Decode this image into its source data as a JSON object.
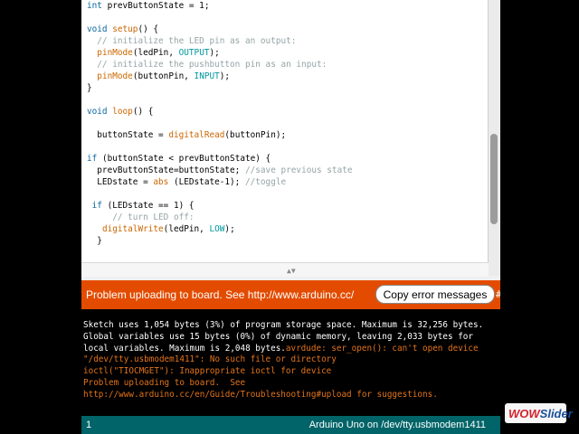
{
  "editor": {
    "code_lines": [
      [
        {
          "t": "int",
          "c": "kw"
        },
        {
          "t": " prevButtonState = 1;"
        }
      ],
      [],
      [
        {
          "t": "void",
          "c": "kw"
        },
        {
          "t": " "
        },
        {
          "t": "setup",
          "c": "fn"
        },
        {
          "t": "() {"
        }
      ],
      [
        {
          "t": "  // initialize the LED pin as an output:",
          "c": "cm"
        }
      ],
      [
        {
          "t": "  "
        },
        {
          "t": "pinMode",
          "c": "fn"
        },
        {
          "t": "(ledPin, "
        },
        {
          "t": "OUTPUT",
          "c": "cst"
        },
        {
          "t": ");"
        }
      ],
      [
        {
          "t": "  // initialize the pushbutton pin as an input:",
          "c": "cm"
        }
      ],
      [
        {
          "t": "  "
        },
        {
          "t": "pinMode",
          "c": "fn"
        },
        {
          "t": "(buttonPin, "
        },
        {
          "t": "INPUT",
          "c": "cst"
        },
        {
          "t": ");"
        }
      ],
      [
        {
          "t": "}"
        }
      ],
      [],
      [
        {
          "t": "void",
          "c": "kw"
        },
        {
          "t": " "
        },
        {
          "t": "loop",
          "c": "fn"
        },
        {
          "t": "() {"
        }
      ],
      [],
      [
        {
          "t": "  buttonState = "
        },
        {
          "t": "digitalRead",
          "c": "fn"
        },
        {
          "t": "(buttonPin);"
        }
      ],
      [],
      [
        {
          "t": "if",
          "c": "kw"
        },
        {
          "t": " (buttonState < prevButtonState) {"
        }
      ],
      [
        {
          "t": "  prevButtonState=buttonState; "
        },
        {
          "t": "//save previous state",
          "c": "cm"
        }
      ],
      [
        {
          "t": "  LEDstate = "
        },
        {
          "t": "abs",
          "c": "fn"
        },
        {
          "t": " (LEDstate-1); "
        },
        {
          "t": "//toggle",
          "c": "cm"
        }
      ],
      [],
      [
        {
          "t": " "
        },
        {
          "t": "if",
          "c": "kw"
        },
        {
          "t": " (LEDstate == 1) {"
        }
      ],
      [
        {
          "t": "     // turn LED off:",
          "c": "cm"
        }
      ],
      [
        {
          "t": "   "
        },
        {
          "t": "digitalWrite",
          "c": "fn"
        },
        {
          "t": "(ledPin, "
        },
        {
          "t": "LOW",
          "c": "cst"
        },
        {
          "t": ");"
        }
      ],
      [
        {
          "t": "  }"
        }
      ]
    ]
  },
  "error_bar": {
    "message": "Problem uploading to board.  See http://www.arduino.cc/",
    "copy_button_label": "Copy error messages",
    "overflow_glyph": "#"
  },
  "console": {
    "lines": [
      [
        {
          "t": "Sketch uses 1,054 bytes (3%) of program storage space. Maximum is 32,256 bytes.",
          "c": "wht"
        }
      ],
      [
        {
          "t": "Global variables use 15 bytes (0%) of dynamic memory, leaving 2,033 bytes for",
          "c": "wht"
        }
      ],
      [
        {
          "t": "local variables. Maximum is 2,048 bytes.",
          "c": "wht"
        },
        {
          "t": "avrdude: ser_open(): can't open device",
          "c": "org"
        }
      ],
      [
        {
          "t": "\"/dev/tty.usbmodem1411\": No such file or directory",
          "c": "org"
        }
      ],
      [
        {
          "t": "ioctl(\"TIOCMGET\"): Inappropriate ioctl for device",
          "c": "org"
        }
      ],
      [
        {
          "t": "Problem uploading to board.  See",
          "c": "org"
        }
      ],
      [
        {
          "t": "http://www.arduino.cc/en/Guide/Troubleshooting#upload for suggestions.",
          "c": "org"
        }
      ]
    ]
  },
  "status_bar": {
    "line_number": "1",
    "board": "Arduino Uno on /dev/tty.usbmodem1411"
  },
  "watermark": {
    "part1": "WOW",
    "part2": "Slider"
  },
  "colors": {
    "error_bar": "#e34c00",
    "status_bar": "#006468",
    "console_error_text": "#e3741b"
  }
}
